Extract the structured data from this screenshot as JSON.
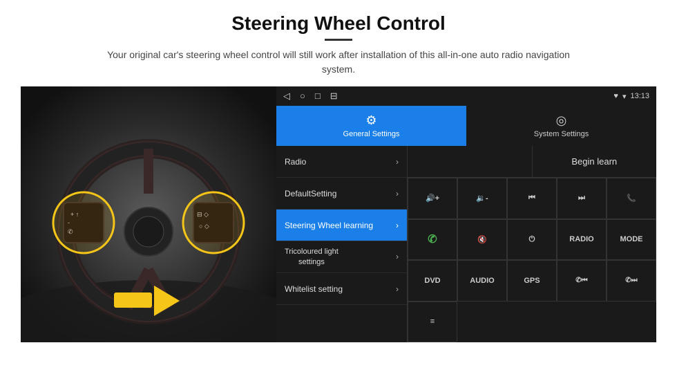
{
  "header": {
    "title": "Steering Wheel Control",
    "subtitle": "Your original car's steering wheel control will still work after installation of this all-in-one auto radio navigation system."
  },
  "status_bar": {
    "nav_icons": [
      "◁",
      "○",
      "□",
      "⊟"
    ],
    "status_icons": [
      "♥",
      "▾",
      "13:13"
    ]
  },
  "tabs": [
    {
      "id": "general",
      "icon": "⚙",
      "label": "General Settings",
      "active": true
    },
    {
      "id": "system",
      "icon": "◎",
      "label": "System Settings",
      "active": false
    }
  ],
  "menu_items": [
    {
      "id": "radio",
      "label": "Radio",
      "active": false
    },
    {
      "id": "default",
      "label": "DefaultSetting",
      "active": false
    },
    {
      "id": "steering",
      "label": "Steering Wheel learning",
      "active": true
    },
    {
      "id": "tricoloured",
      "label": "Tricoloured light settings",
      "active": false
    },
    {
      "id": "whitelist",
      "label": "Whitelist setting",
      "active": false
    }
  ],
  "begin_learn_label": "Begin learn",
  "grid_buttons": [
    {
      "id": "vol-up",
      "label": "◀+",
      "row": 1
    },
    {
      "id": "vol-down",
      "label": "◀-",
      "row": 1
    },
    {
      "id": "prev-track",
      "label": "⏮",
      "row": 1
    },
    {
      "id": "next-track",
      "label": "⏭",
      "row": 1
    },
    {
      "id": "phone",
      "label": "✆",
      "row": 1
    },
    {
      "id": "call-accept",
      "label": "✆",
      "row": 2
    },
    {
      "id": "mute",
      "label": "◀✕",
      "row": 2
    },
    {
      "id": "power",
      "label": "⏻",
      "row": 2
    },
    {
      "id": "radio-btn",
      "label": "RADIO",
      "row": 2
    },
    {
      "id": "mode-btn",
      "label": "MODE",
      "row": 2
    },
    {
      "id": "dvd-btn",
      "label": "DVD",
      "row": 3
    },
    {
      "id": "audio-btn",
      "label": "AUDIO",
      "row": 3
    },
    {
      "id": "gps-btn",
      "label": "GPS",
      "row": 3
    },
    {
      "id": "tel-prev",
      "label": "✆⏮",
      "row": 3
    },
    {
      "id": "tel-next",
      "label": "✆⏭",
      "row": 3
    },
    {
      "id": "list-icon",
      "label": "≡",
      "row": 4
    }
  ]
}
